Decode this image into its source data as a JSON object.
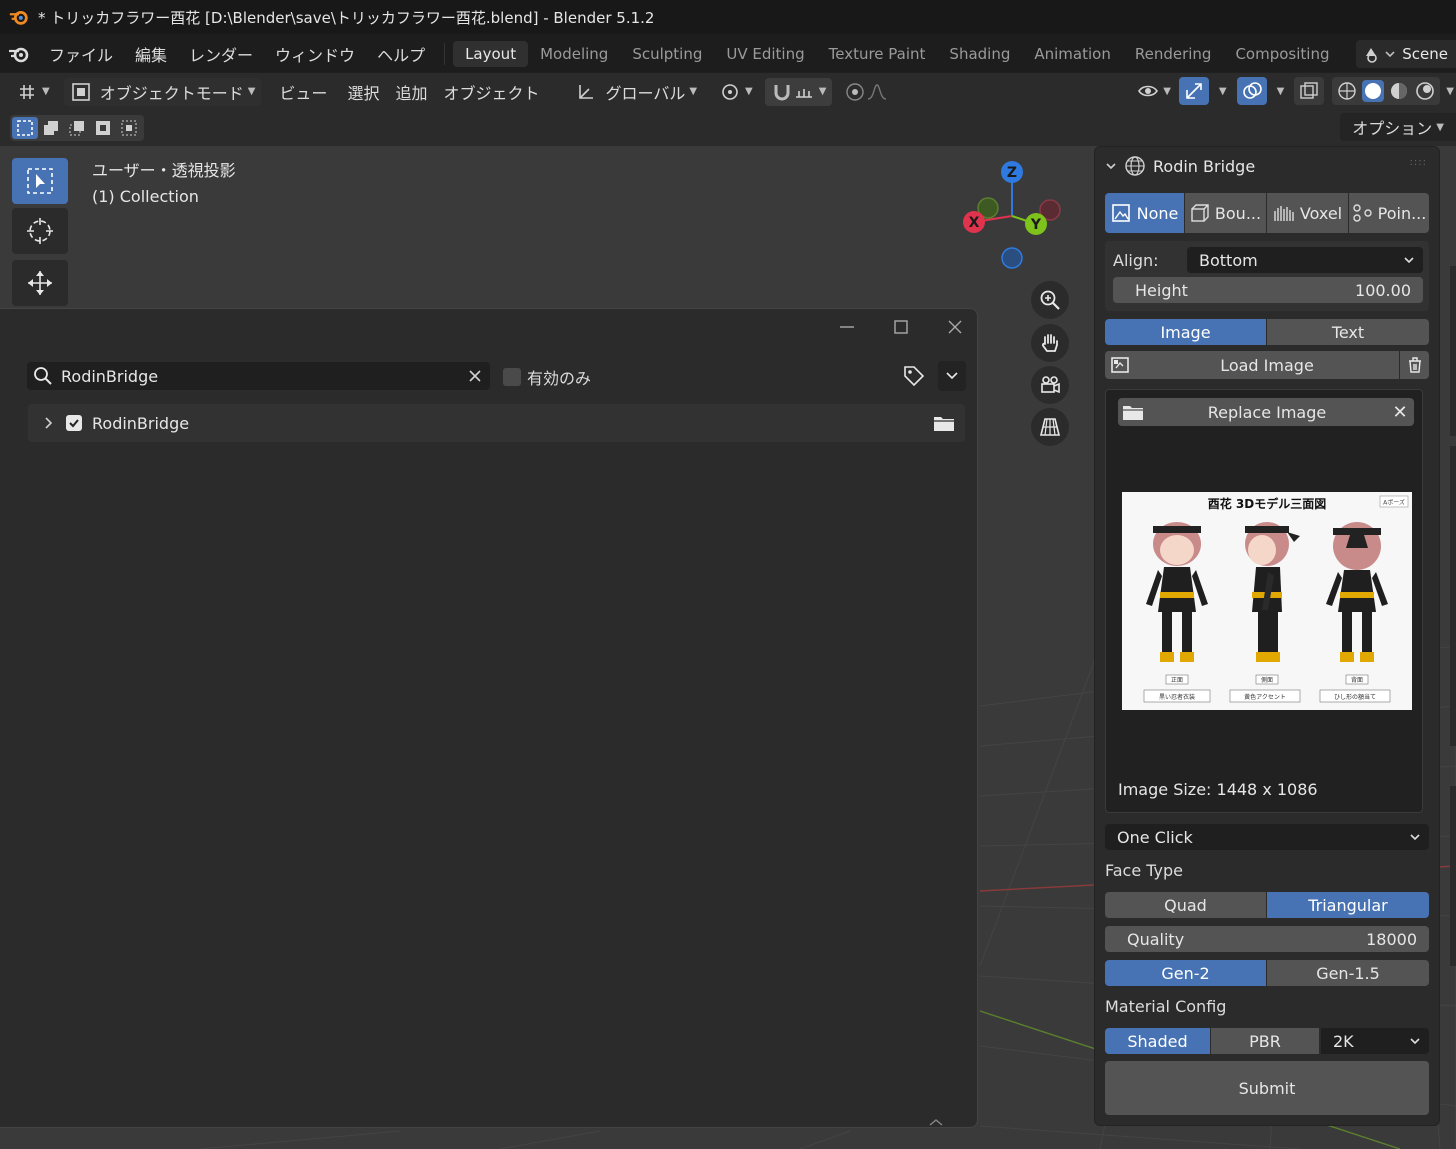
{
  "window": {
    "title": "* トリッカフラワー酉花 [D:\\Blender\\save\\トリッカフラワー酉花.blend] - Blender 5.1.2"
  },
  "menu": {
    "items": [
      "ファイル",
      "編集",
      "レンダー",
      "ウィンドウ",
      "ヘルプ"
    ],
    "workspaces": [
      "Layout",
      "Modeling",
      "Sculpting",
      "UV Editing",
      "Texture Paint",
      "Shading",
      "Animation",
      "Rendering",
      "Compositing"
    ],
    "active_workspace": "Layout",
    "scene_label": "Scene"
  },
  "header": {
    "mode": "オブジェクトモード",
    "view": "ビュー",
    "select": "選択",
    "add": "追加",
    "object": "オブジェクト",
    "orientation": "グローバル"
  },
  "options": "オプション",
  "viewport": {
    "view_name": "ユーザー・透視投影",
    "collection": "(1) Collection"
  },
  "gizmo": {
    "x": "X",
    "y": "Y",
    "z": "Z"
  },
  "dialog": {
    "search_value": "RodinBridge",
    "enabled_only": "有効のみ",
    "addon_name": "RodinBridge",
    "addon_checked": true
  },
  "panel": {
    "title": "Rodin Bridge",
    "bbox_modes": [
      "None",
      "Bou...",
      "Voxel",
      "Poin..."
    ],
    "bbox_active": "None",
    "align_label": "Align:",
    "align_value": "Bottom",
    "height_label": "Height",
    "height_value": "100.00",
    "input_tabs": [
      "Image",
      "Text"
    ],
    "input_active": "Image",
    "load_image": "Load Image",
    "replace_image": "Replace Image",
    "preview_title": "酉花 3Dモデル三面図",
    "preview_tag": "Aポーズ",
    "preview_views": [
      "正面",
      "側面",
      "背面"
    ],
    "preview_captions": [
      "黒い忍者衣装",
      "黄色アクセント",
      "ひし形の額当て"
    ],
    "image_size": "Image Size: 1448 x 1086",
    "mode_select": "One Click",
    "face_type_label": "Face Type",
    "face_types": [
      "Quad",
      "Triangular"
    ],
    "face_type_active": "Triangular",
    "quality_label": "Quality",
    "quality_value": "18000",
    "gen_versions": [
      "Gen-2",
      "Gen-1.5"
    ],
    "gen_active": "Gen-2",
    "material_label": "Material Config",
    "material_modes": [
      "Shaded",
      "PBR"
    ],
    "material_active": "Shaded",
    "resolution": "2K",
    "submit": "Submit"
  },
  "colors": {
    "accent": "#4772b3",
    "x_axis": "#e0344e",
    "y_axis": "#7ec21c",
    "z_axis": "#2f7ae0",
    "panel_bg": "#2b2b2b"
  }
}
